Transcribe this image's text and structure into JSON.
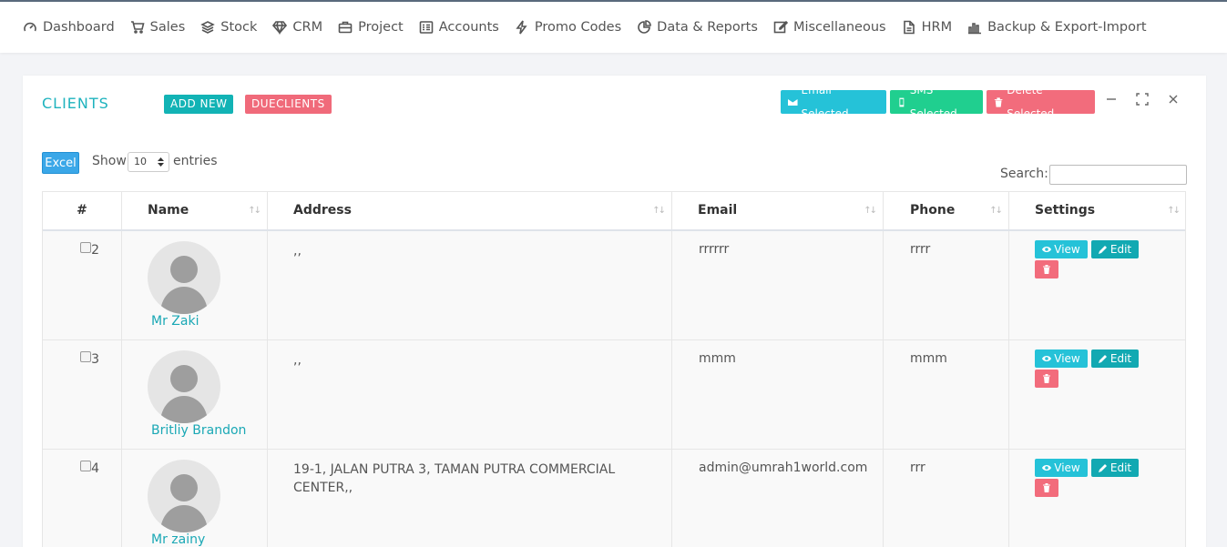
{
  "nav": [
    {
      "label": "Dashboard",
      "icon": "dashboard-icon"
    },
    {
      "label": "Sales",
      "icon": "cart-icon"
    },
    {
      "label": "Stock",
      "icon": "layers-icon"
    },
    {
      "label": "CRM",
      "icon": "diamond-icon"
    },
    {
      "label": "Project",
      "icon": "briefcase-icon"
    },
    {
      "label": "Accounts",
      "icon": "ledger-icon"
    },
    {
      "label": "Promo Codes",
      "icon": "bolt-icon"
    },
    {
      "label": "Data & Reports",
      "icon": "pie-icon"
    },
    {
      "label": "Miscellaneous",
      "icon": "edit-icon"
    },
    {
      "label": "HRM",
      "icon": "file-icon"
    },
    {
      "label": "Backup & Export-Import",
      "icon": "bar-chart-icon"
    }
  ],
  "card": {
    "title": "CLIENTS",
    "add_new": "ADD NEW",
    "due_clients": "DUECLIENTS",
    "email_selected": "Email Selected",
    "sms_selected": "SMS Selected",
    "delete_selected": "Delete Selected"
  },
  "toolbar": {
    "excel": "Excel",
    "show": "Show",
    "entries_value": "10",
    "entries": "entries",
    "search_label": "Search:",
    "search_value": ""
  },
  "table": {
    "headers": [
      "#",
      "Name",
      "Address",
      "Email",
      "Phone",
      "Settings"
    ],
    "rows": [
      {
        "index": "2",
        "name": "Mr Zaki",
        "address": ",,",
        "email": "rrrrrr",
        "phone": "rrrr"
      },
      {
        "index": "3",
        "name": "Britliy Brandon",
        "address": ",,",
        "email": "mmm",
        "phone": "mmm"
      },
      {
        "index": "4",
        "name": "Mr zainy",
        "address": "19-1, JALAN PUTRA 3, TAMAN PUTRA COMMERCIAL CENTER,,",
        "email": "admin@umrah1world.com",
        "phone": "rrr"
      }
    ],
    "actions": {
      "view": "View",
      "edit": "Edit"
    }
  }
}
